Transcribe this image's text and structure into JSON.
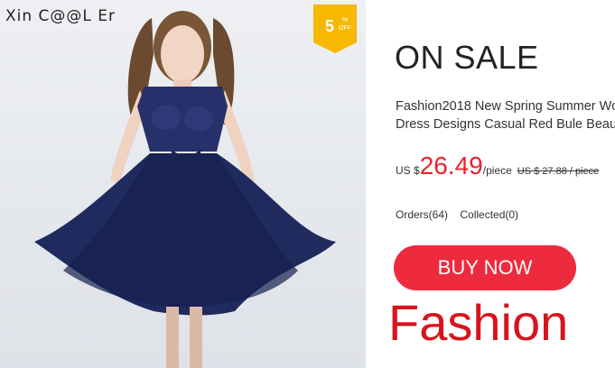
{
  "brand": "Xin C@@L Er",
  "badge": {
    "number": "5",
    "percent": "%",
    "off": "OFF",
    "color": "#f6b800"
  },
  "heading": "ON SALE",
  "description": {
    "line1": "Fashion2018 New Spring Summer Wo",
    "line2": "Dress Designs Casual Red Bule Beaut"
  },
  "price": {
    "currency": "US $",
    "value": "26.49",
    "unit": "/piece",
    "old": "US $ 27.88 / piece"
  },
  "stats": {
    "orders": "Orders(64)",
    "collected": "Collected(0)"
  },
  "buy_button": {
    "label": "BUY NOW",
    "color": "#ed2a3e"
  },
  "footer_text": "Fashion",
  "colors": {
    "price": "#e8222c",
    "fashion": "#d7141d",
    "dress": "#1f2a5e"
  }
}
